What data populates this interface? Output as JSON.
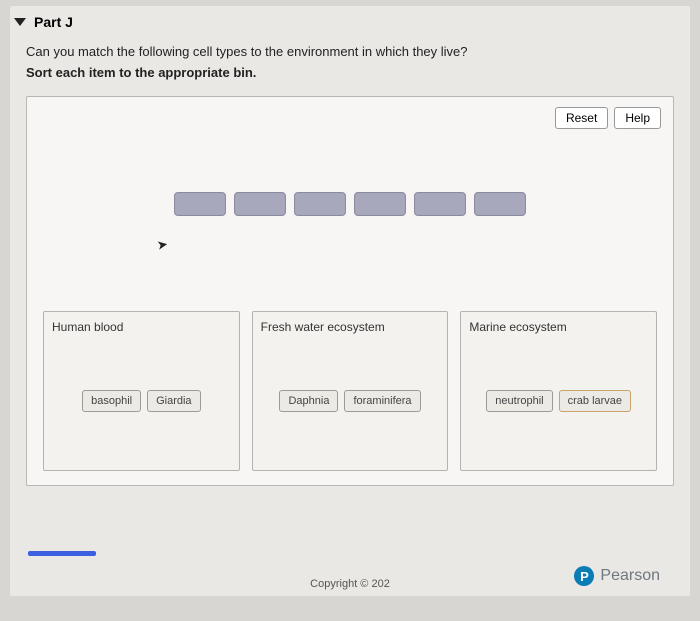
{
  "part": {
    "label": "Part J"
  },
  "question": {
    "text": "Can you match the following cell types to the environment in which they live?",
    "instruction": "Sort each item to the appropriate bin."
  },
  "controls": {
    "reset": "Reset",
    "help": "Help"
  },
  "bins": [
    {
      "label": "Human blood",
      "items": [
        "basophil",
        "Giardia"
      ]
    },
    {
      "label": "Fresh water ecosystem",
      "items": [
        "Daphnia",
        "foraminifera"
      ]
    },
    {
      "label": "Marine ecosystem",
      "items": [
        "neutrophil",
        "crab larvae"
      ]
    }
  ],
  "footer": {
    "copyright": "Copyright © 202",
    "brand": "Pearson",
    "brand_letter": "P"
  }
}
